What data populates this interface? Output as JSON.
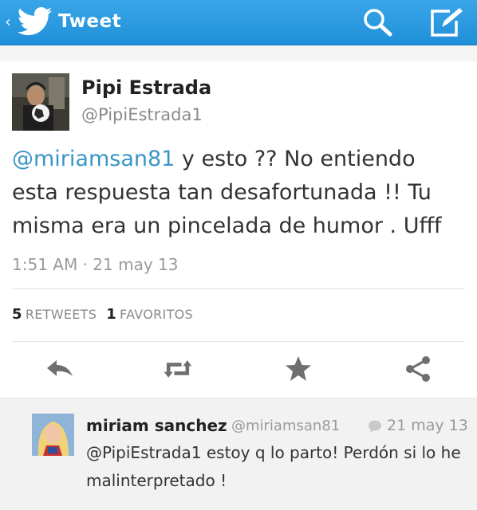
{
  "header": {
    "back_glyph": "‹",
    "title": "Tweet",
    "icons": [
      "twitter-bird-icon",
      "search-icon",
      "compose-icon"
    ]
  },
  "tweet": {
    "name": "Pipi Estrada",
    "handle": "@PipiEstrada1",
    "mention": "@miriamsan81",
    "text": " y esto ?? No entiendo esta respuesta tan desafortunada !! Tu misma era un pincelada de humor . Ufff",
    "timestamp": "1:51 AM · 21 may 13",
    "retweets_count": "5",
    "retweets_label": "RETWEETS",
    "favorites_count": "1",
    "favorites_label": "FAVORITOS",
    "actions": [
      "reply-icon",
      "retweet-icon",
      "favorite-icon",
      "share-icon"
    ]
  },
  "reply": {
    "name": "miriam sanchez",
    "handle": "@miriamsan81",
    "date": "21 may 13",
    "text": "@PipiEstrada1 estoy q lo parto! Perdón si lo he malinterpretado !"
  },
  "colors": {
    "header_blue": "#2a9ae0",
    "mention_blue": "#3b95c8",
    "icon_gray": "#6f6f6f"
  }
}
